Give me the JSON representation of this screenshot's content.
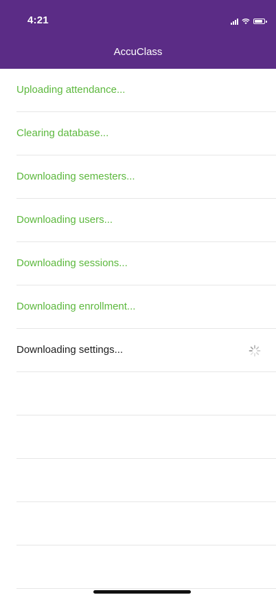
{
  "status_bar": {
    "time": "4:21",
    "icons": [
      "signal-icon",
      "wifi-icon",
      "battery-icon"
    ]
  },
  "header": {
    "title": "AccuClass",
    "background_color": "#5b2c86"
  },
  "colors": {
    "done_text": "#5cb83d",
    "active_text": "#1d1d1d",
    "separator": "#e6e6e6"
  },
  "sync_steps": [
    {
      "label": "Uploading attendance...",
      "state": "done"
    },
    {
      "label": "Clearing database...",
      "state": "done"
    },
    {
      "label": "Downloading semesters...",
      "state": "done"
    },
    {
      "label": "Downloading users...",
      "state": "done"
    },
    {
      "label": "Downloading sessions...",
      "state": "done"
    },
    {
      "label": "Downloading enrollment...",
      "state": "done"
    },
    {
      "label": "Downloading settings...",
      "state": "in-progress"
    }
  ]
}
